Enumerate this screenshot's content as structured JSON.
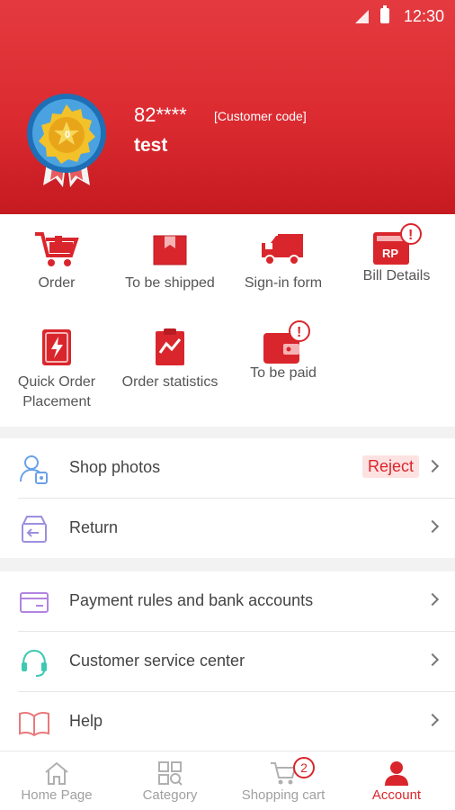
{
  "status_bar": {
    "time": "12:30"
  },
  "profile": {
    "user_id": "82****",
    "customer_code_label": "[Customer code]",
    "name": "test",
    "medal_level": "0"
  },
  "grid": [
    {
      "label": "Order",
      "icon": "cart-icon"
    },
    {
      "label": "To be shipped",
      "icon": "box-icon"
    },
    {
      "label": "Sign-in form",
      "icon": "truck-icon"
    },
    {
      "label": "Bill Details",
      "icon": "bill-icon",
      "alert": "!"
    },
    {
      "label": "Quick Order Placement",
      "icon": "lightning-icon"
    },
    {
      "label": "Order statistics",
      "icon": "statistics-icon"
    },
    {
      "label": "To be paid",
      "icon": "wallet-icon",
      "alert": "!"
    }
  ],
  "bill_icon_text": "RP",
  "list_group_1": [
    {
      "label": "Shop photos",
      "icon": "shop-photo-icon",
      "status": "Reject"
    },
    {
      "label": "Return",
      "icon": "return-icon"
    }
  ],
  "list_group_2": [
    {
      "label": "Payment rules and bank accounts",
      "icon": "card-icon"
    },
    {
      "label": "Customer service center",
      "icon": "headset-icon"
    },
    {
      "label": "Help",
      "icon": "book-icon"
    }
  ],
  "tabs": [
    {
      "label": "Home Page",
      "icon": "home-icon"
    },
    {
      "label": "Category",
      "icon": "category-icon"
    },
    {
      "label": "Shopping cart",
      "icon": "cart-icon",
      "badge": "2"
    },
    {
      "label": "Account",
      "icon": "person-icon",
      "active": true
    }
  ],
  "colors": {
    "primary": "#d9262c",
    "header": "#e43a3f",
    "background": "#f2f2f2"
  }
}
